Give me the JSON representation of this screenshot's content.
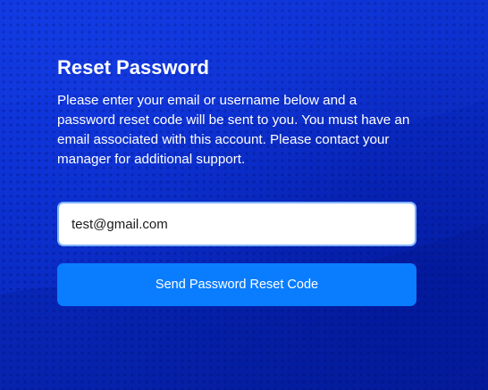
{
  "reset_form": {
    "title": "Reset Password",
    "description": "Please enter your email or username below and a password reset code will be sent to you. You must have an email associated with this account. Please contact your manager for additional support.",
    "email_value": "test@gmail.com",
    "submit_label": "Send Password Reset Code"
  },
  "colors": {
    "background": "#0a2fd1",
    "button": "#0a7dff",
    "input_border": "#7fb2ff",
    "text": "#ffffff"
  }
}
